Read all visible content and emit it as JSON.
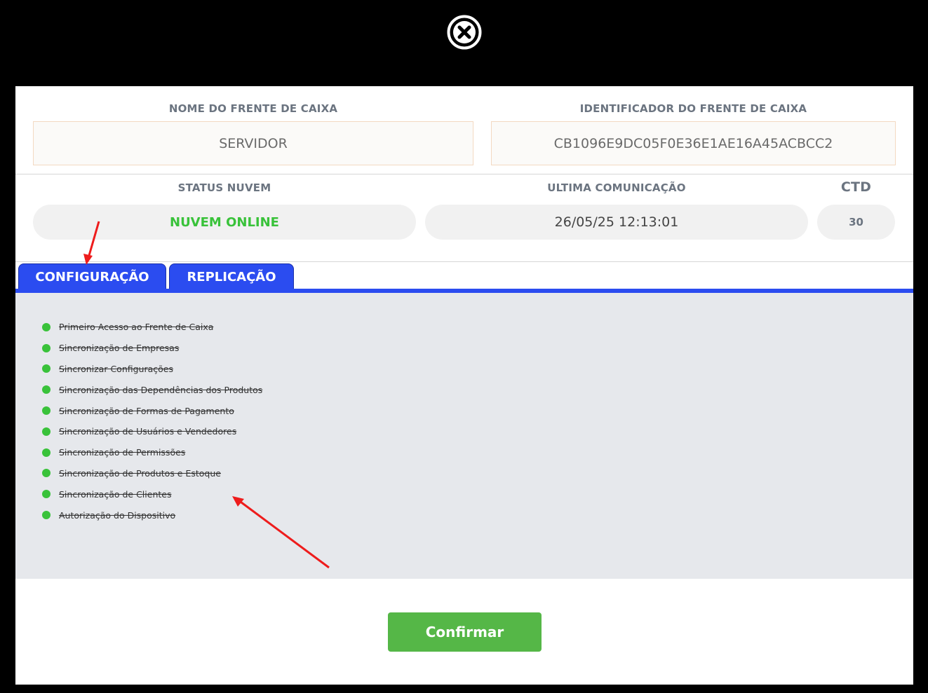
{
  "close_icon": "close-circle-icon",
  "fields": {
    "pos_name_label": "NOME DO FRENTE DE CAIXA",
    "pos_name_value": "SERVIDOR",
    "pos_id_label": "IDENTIFICADOR DO FRENTE DE CAIXA",
    "pos_id_value": "CB1096E9DC05F0E36E1AE16A45ACBCC2"
  },
  "status": {
    "cloud_label": "STATUS NUVEM",
    "cloud_value": "NUVEM ONLINE",
    "last_comm_label": "ULTIMA COMUNICAÇÃO",
    "last_comm_value": "26/05/25 12:13:01",
    "ctd_label": "CTD",
    "ctd_value": "30"
  },
  "tabs": [
    {
      "label": "CONFIGURAÇÃO",
      "active": true
    },
    {
      "label": "REPLICAÇÃO",
      "active": false
    }
  ],
  "steps": [
    "Primeiro Acesso ao Frente de Caixa",
    "Sincronização de Empresas",
    "Sincronizar Configurações",
    "Sincronização das Dependências dos Produtos",
    "Sincronização de Formas de Pagamento",
    "Sincronização de Usuários e Vendedores",
    "Sincronização de Permissões",
    "Sincronização de Produtos e Estoque",
    "Sincronização de Clientes",
    "Autorização do Dispositivo"
  ],
  "confirm_label": "Confirmar",
  "colors": {
    "accent_blue": "#2b4cf0",
    "online_green": "#39c23a",
    "confirm_green": "#55b747",
    "annotation_red": "#ee1c1c"
  }
}
